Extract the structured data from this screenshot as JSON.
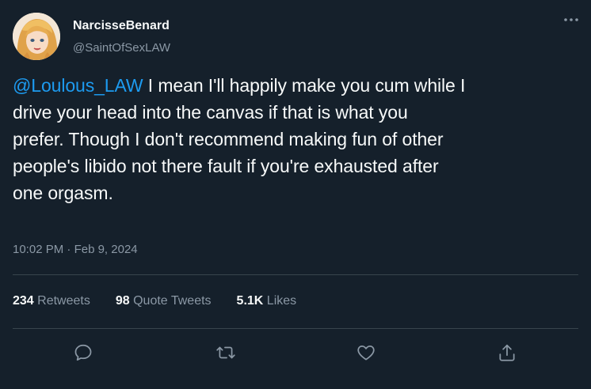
{
  "author": {
    "display_name": "NarcisseBenard",
    "handle": "@SaintOfSexLAW"
  },
  "tweet": {
    "mention": "@Loulous_LAW",
    "body": " I mean I'll happily make you cum while I\ndrive your head into the canvas if that is what you\nprefer. Though I don't recommend making fun of other\npeople's libido not there fault if you're exhausted after\none orgasm."
  },
  "meta": {
    "time": "10:02 PM",
    "separator": " · ",
    "date": "Feb 9, 2024"
  },
  "stats": {
    "retweets_count": "234",
    "retweets_label": "Retweets",
    "quotes_count": "98",
    "quotes_label": "Quote Tweets",
    "likes_count": "5.1K",
    "likes_label": "Likes"
  },
  "icons": {
    "more": "more-horizontal-icon",
    "reply": "reply-icon",
    "retweet": "retweet-icon",
    "like": "heart-icon",
    "share": "share-icon"
  },
  "colors": {
    "background": "#15202b",
    "text": "#f7f9f9",
    "secondary": "#8b98a5",
    "accent": "#1d9bf0",
    "divider": "#38444d"
  }
}
